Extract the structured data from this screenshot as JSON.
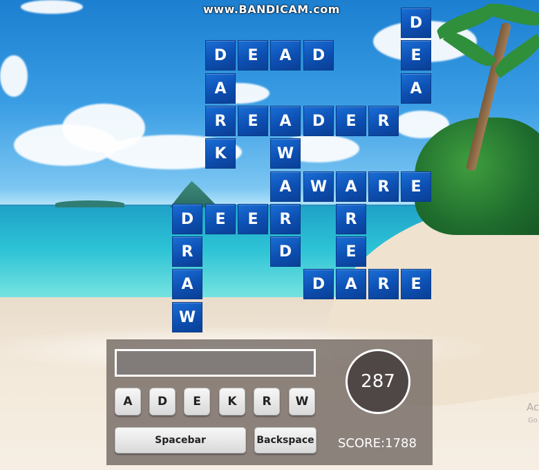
{
  "watermark": "www.BANDICAM.com",
  "grid": {
    "tiles": [
      {
        "letter": "D",
        "col": 8,
        "row": 0
      },
      {
        "letter": "D",
        "col": 2,
        "row": 1
      },
      {
        "letter": "E",
        "col": 3,
        "row": 1
      },
      {
        "letter": "A",
        "col": 4,
        "row": 1
      },
      {
        "letter": "D",
        "col": 5,
        "row": 1
      },
      {
        "letter": "E",
        "col": 8,
        "row": 1
      },
      {
        "letter": "A",
        "col": 2,
        "row": 2
      },
      {
        "letter": "A",
        "col": 8,
        "row": 2
      },
      {
        "letter": "R",
        "col": 2,
        "row": 3
      },
      {
        "letter": "E",
        "col": 3,
        "row": 3
      },
      {
        "letter": "A",
        "col": 4,
        "row": 3
      },
      {
        "letter": "D",
        "col": 5,
        "row": 3
      },
      {
        "letter": "E",
        "col": 6,
        "row": 3
      },
      {
        "letter": "R",
        "col": 7,
        "row": 3
      },
      {
        "letter": "K",
        "col": 2,
        "row": 4
      },
      {
        "letter": "W",
        "col": 4,
        "row": 4
      },
      {
        "letter": "A",
        "col": 4,
        "row": 5
      },
      {
        "letter": "W",
        "col": 5,
        "row": 5
      },
      {
        "letter": "A",
        "col": 6,
        "row": 5
      },
      {
        "letter": "R",
        "col": 7,
        "row": 5
      },
      {
        "letter": "E",
        "col": 8,
        "row": 5
      },
      {
        "letter": "D",
        "col": 1,
        "row": 6
      },
      {
        "letter": "E",
        "col": 2,
        "row": 6
      },
      {
        "letter": "E",
        "col": 3,
        "row": 6
      },
      {
        "letter": "R",
        "col": 4,
        "row": 6
      },
      {
        "letter": "R",
        "col": 6,
        "row": 6
      },
      {
        "letter": "R",
        "col": 1,
        "row": 7
      },
      {
        "letter": "D",
        "col": 4,
        "row": 7
      },
      {
        "letter": "E",
        "col": 6,
        "row": 7
      },
      {
        "letter": "A",
        "col": 1,
        "row": 8
      },
      {
        "letter": "D",
        "col": 5,
        "row": 8
      },
      {
        "letter": "A",
        "col": 6,
        "row": 8
      },
      {
        "letter": "R",
        "col": 7,
        "row": 8
      },
      {
        "letter": "E",
        "col": 8,
        "row": 8
      },
      {
        "letter": "W",
        "col": 1,
        "row": 9
      }
    ]
  },
  "input": {
    "value": ""
  },
  "letters": [
    "A",
    "D",
    "E",
    "K",
    "R",
    "W"
  ],
  "buttons": {
    "spacebar": "Spacebar",
    "backspace": "Backspace"
  },
  "timer": "287",
  "score": "SCORE:1788",
  "os_overlay": {
    "line1": "Ac",
    "line2": "Go"
  }
}
